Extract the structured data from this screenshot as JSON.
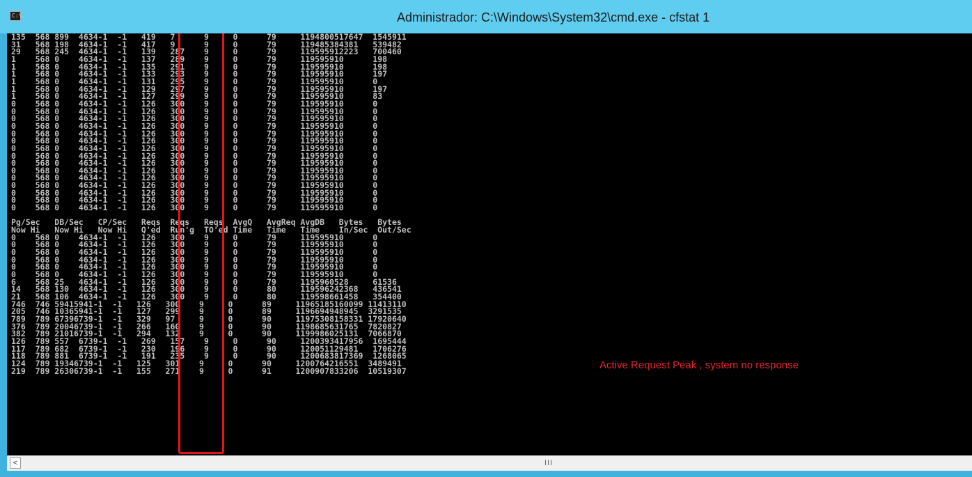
{
  "window": {
    "title": "Administrador: C:\\Windows\\System32\\cmd.exe - cfstat  1",
    "icon": "cmd-icon",
    "icon_text": "C:\\."
  },
  "console": {
    "lines": [
      "135  568 899  4634-1  -1   419   7      9     0      79     1194800517647  1545911",
      "31   568 198  4634-1  -1   417   9      9     0      79     119485384381   539482",
      "29   568 245  4634-1  -1   139   287    9     0      79     119595912223   700460",
      "1    568 0    4634-1  -1   137   289    9     0      79     119595910      198",
      "1    568 0    4634-1  -1   135   291    9     0      79     119595910      198",
      "1    568 0    4634-1  -1   133   293    9     0      79     119595910      197",
      "1    568 0    4634-1  -1   131   295    9     0      79     119595910      0",
      "1    568 0    4634-1  -1   129   297    9     0      79     119595910      197",
      "1    568 0    4634-1  -1   127   299    9     0      79     119595910      83",
      "0    568 0    4634-1  -1   126   300    9     0      79     119595910      0",
      "0    568 0    4634-1  -1   126   300    9     0      79     119595910      0",
      "0    568 0    4634-1  -1   126   300    9     0      79     119595910      0",
      "0    568 0    4634-1  -1   126   300    9     0      79     119595910      0",
      "0    568 0    4634-1  -1   126   300    9     0      79     119595910      0",
      "0    568 0    4634-1  -1   126   300    9     0      79     119595910      0",
      "0    568 0    4634-1  -1   126   300    9     0      79     119595910      0",
      "0    568 0    4634-1  -1   126   300    9     0      79     119595910      0",
      "0    568 0    4634-1  -1   126   300    9     0      79     119595910      0",
      "0    568 0    4634-1  -1   126   300    9     0      79     119595910      0",
      "0    568 0    4634-1  -1   126   300    9     0      79     119595910      0",
      "0    568 0    4634-1  -1   126   300    9     0      79     119595910      0",
      "0    568 0    4634-1  -1   126   300    9     0      79     119595910      0",
      "0    568 0    4634-1  -1   126   300    9     0      79     119595910      0",
      "0    568 0    4634-1  -1   126   300    9     0      79     119595910      0",
      "",
      "Pg/Sec   DB/Sec   CP/Sec   Reqs  Reqs   Reqs  AvgQ   AvgReq AvgDB   Bytes   Bytes",
      "Now Hi   Now Hi   Now Hi   Q'ed  Run'g  TO'ed Time   Time   Time    In/Sec  Out/Sec",
      "0    568 0    4634-1  -1   126   300    9     0      79     119595910      0",
      "0    568 0    4634-1  -1   126   300    9     0      79     119595910      0",
      "0    568 0    4634-1  -1   126   300    9     0      79     119595910      0",
      "0    568 0    4634-1  -1   126   300    9     0      79     119595910      0",
      "0    568 0    4634-1  -1   126   300    9     0      79     119595910      0",
      "0    568 0    4634-1  -1   126   300    9     0      79     119595910      0",
      "6    568 25   4634-1  -1   126   300    9     0      79     1195960528     61536",
      "14   568 130  4634-1  -1   126   300    9     0      80     119596242368   436541",
      "21   568 106  4634-1  -1   126   300    9     0      80     119598661458   354400",
      "746  746 59415941-1  -1   126   300    9     0      89     11965185160099 11413110",
      "205  746 10365941-1  -1   127   299    9     0      89     1196694948945  3291535",
      "789  789 67396739-1  -1   329   97     9     0      90     11975308158331 17920640",
      "376  789 20046739-1  -1   266   160    9     0      90     1198685631765  7820827",
      "382  789 21016739-1  -1   294   132    9     0      90     1199986025131  7066870",
      "126  789 557  6739-1  -1   269   157    9     0      90     1200393417956  1695444",
      "117  789 682  6739-1  -1   230   196    9     0      90     120051129481   1706276",
      "118  789 881  6739-1  -1   191   235    9     0      90     1200683817369  1268065",
      "124  789 19346739-1  -1   125   301    9     0      90     1200764216551  3489491",
      "219  789 26306739-1  -1   155   271    9     0      91     1200907833206  10519307"
    ]
  },
  "annotation": {
    "text": "Active Request Peak , system no response",
    "color": "#e8262b"
  },
  "highlight_color": "#e4141c",
  "scrollbar": {
    "left_arrow": "<",
    "grip": "III"
  }
}
